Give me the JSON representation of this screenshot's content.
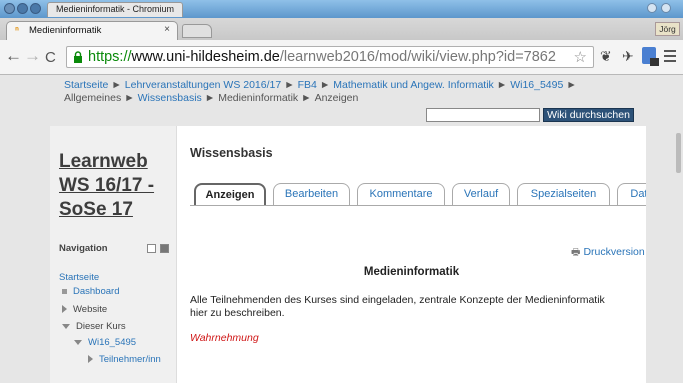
{
  "window": {
    "title": "Medieninformatik - Chromium"
  },
  "tab": {
    "title": "Medieninformatik",
    "favicon": "moodle-icon",
    "close_glyph": "×"
  },
  "user_badge": "Jörg",
  "address": {
    "scheme": "https://",
    "host": "www.uni-hildesheim.de",
    "path": "/learnweb2016/mod/wiki/view.php?id=7862"
  },
  "breadcrumb": {
    "items": [
      "Startseite",
      "Lehrveranstaltungen WS 2016/17",
      "FB4",
      "Mathematik und Angew. Informatik",
      "Wi16_5495",
      "Allgemeines",
      "Wissensbasis",
      "Medieninformatik",
      "Anzeigen"
    ],
    "separator": "►"
  },
  "search": {
    "placeholder": "",
    "button_label": "Wiki durchsuchen"
  },
  "course": {
    "title": "Learnweb WS 16/17 - SoSe 17"
  },
  "navigation": {
    "heading": "Navigation",
    "items": [
      "Startseite",
      "Dashboard",
      "Website",
      "Dieser Kurs",
      "Wi16_5495",
      "Teilnehmer/inn"
    ]
  },
  "main": {
    "heading": "Wissensbasis",
    "tabs": [
      "Anzeigen",
      "Bearbeiten",
      "Kommentare",
      "Verlauf",
      "Spezialseiten",
      "Date"
    ],
    "print_label": "Druckversion",
    "wiki_title": "Medieninformatik",
    "text": "Alle Teilnehmenden des Kurses sind eingeladen, zentrale Konzepte der Medieninformatik hier zu beschreiben.",
    "link": "Wahrnehmung"
  },
  "colors": {
    "link": "#2a74b8",
    "red_link": "#d01818",
    "secure_scheme": "#0a8a0a",
    "search_button": "#2d5278"
  }
}
